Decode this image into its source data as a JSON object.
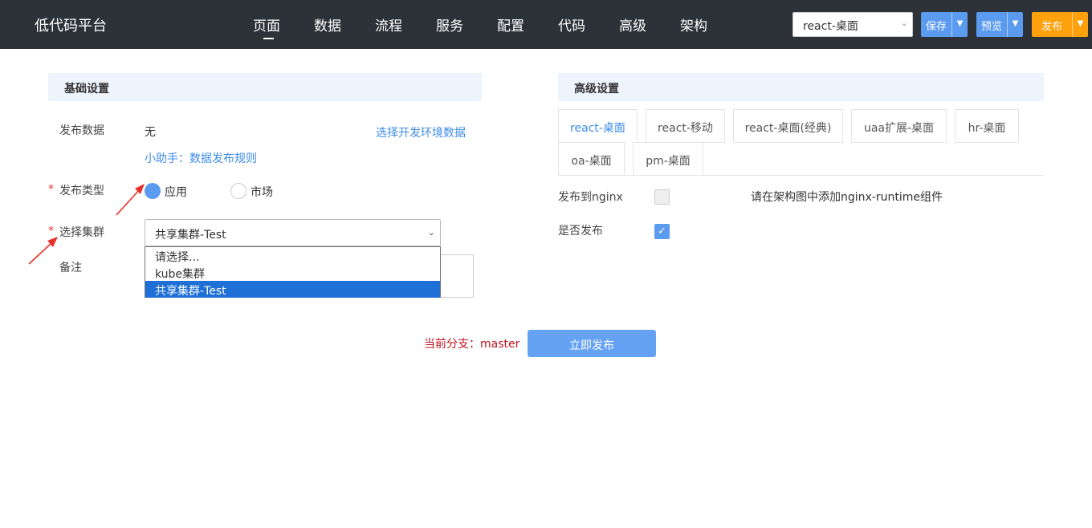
{
  "app": {
    "title": "低代码平台"
  },
  "nav": {
    "items": [
      "页面",
      "数据",
      "流程",
      "服务",
      "配置",
      "代码",
      "高级",
      "架构"
    ],
    "active_index": 0
  },
  "toolbar": {
    "env_select": "react-桌面",
    "save_label": "保存",
    "preview_label": "预览",
    "publish_label": "发布"
  },
  "basic": {
    "header": "基础设置",
    "publish_data_label": "发布数据",
    "publish_data_value": "无",
    "select_env_link": "选择开发环境数据",
    "helper_link": "小助手：数据发布规则",
    "publish_type_label": "发布类型",
    "type_options": [
      "应用",
      "市场"
    ],
    "type_selected": "应用",
    "cluster_label": "选择集群",
    "cluster_value": "共享集群-Test",
    "cluster_options": [
      "请选择...",
      "kube集群",
      "共享集群-Test"
    ],
    "remark_label": "备注",
    "required_mark": "*"
  },
  "advanced": {
    "header": "高级设置",
    "tabs": [
      "react-桌面",
      "react-移动",
      "react-桌面(经典)",
      "uaa扩展-桌面",
      "hr-桌面",
      "oa-桌面",
      "pm-桌面"
    ],
    "active_tab": "react-桌面",
    "nginx_label": "发布到nginx",
    "nginx_checked": false,
    "nginx_hint": "请在架构图中添加nginx-runtime组件",
    "do_publish_label": "是否发布",
    "do_publish_checked": true
  },
  "footer": {
    "branch": "当前分支：master",
    "publish_now": "立即发布"
  },
  "colors": {
    "topbar": "#2d3239",
    "accent": "#5b9bef",
    "publish": "#fea10c",
    "branch": "#c0141f"
  }
}
